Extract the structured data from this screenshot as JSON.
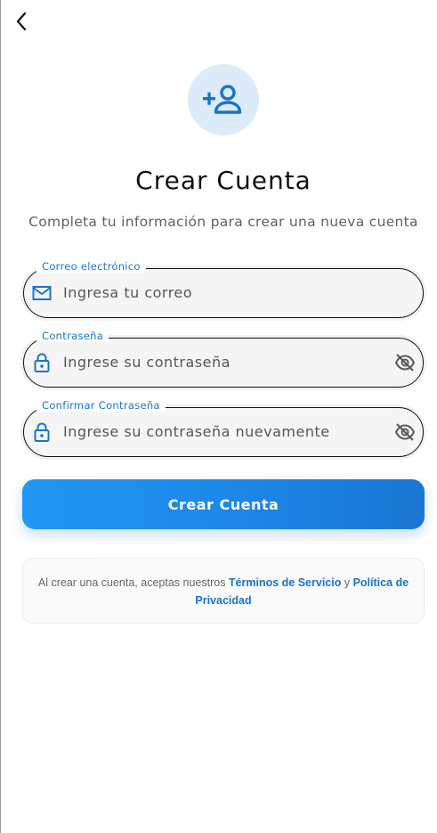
{
  "header": {
    "back_icon": "chevron-left-icon"
  },
  "hero": {
    "icon": "person-add-icon",
    "title": "Crear Cuenta",
    "subtitle": "Completa tu información para crear una nueva cuenta"
  },
  "form": {
    "email": {
      "label": "Correo electrónico",
      "placeholder": "Ingresa tu correo",
      "icon": "mail-icon"
    },
    "password": {
      "label": "Contraseña",
      "placeholder": "Ingrese su contraseña",
      "icon": "lock-icon",
      "toggle_icon": "eye-off-icon"
    },
    "confirm_password": {
      "label": "Confirmar Contraseña",
      "placeholder": "Ingrese su contraseña nuevamente",
      "icon": "lock-icon",
      "toggle_icon": "eye-off-icon"
    },
    "submit_label": "Crear Cuenta"
  },
  "terms": {
    "prefix": "Al crear una cuenta, aceptas nuestros ",
    "terms_link": "Términos de Servicio",
    "connector": " y ",
    "privacy_link": "Política de Privacidad"
  },
  "colors": {
    "accent": "#1a73c8",
    "button_start": "#2196f3",
    "button_end": "#1976d2",
    "avatar_bg": "#dcebf9"
  }
}
